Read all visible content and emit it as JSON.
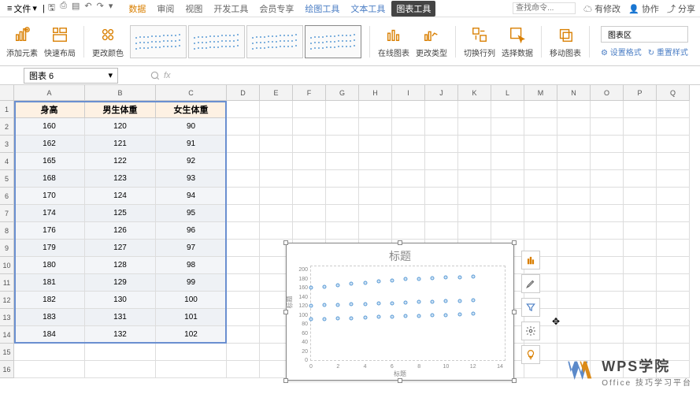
{
  "topbar": {
    "menu": "文件",
    "tabs": [
      "数据",
      "审阅",
      "视图",
      "开发工具",
      "会员专享",
      "绘图工具",
      "文本工具",
      "图表工具"
    ],
    "search_ph": "查找命令...",
    "cloud": "有修改",
    "collab": "协作",
    "share": "分享"
  },
  "ribbon": {
    "g1": "添加元素",
    "g2": "快速布局",
    "g3": "更改颜色",
    "g4": "在线图表",
    "g5": "更改类型",
    "g6": "切换行列",
    "g7": "选择数据",
    "g8": "移动图表",
    "area_label": "图表区",
    "settings": "设置格式",
    "reset": "重置样式"
  },
  "namebox": "图表 6",
  "fx": "fx",
  "table": {
    "headers": [
      "身高",
      "男生体重",
      "女生体重"
    ],
    "rows": [
      [
        "160",
        "120",
        "90"
      ],
      [
        "162",
        "121",
        "91"
      ],
      [
        "165",
        "122",
        "92"
      ],
      [
        "168",
        "123",
        "93"
      ],
      [
        "170",
        "124",
        "94"
      ],
      [
        "174",
        "125",
        "95"
      ],
      [
        "176",
        "126",
        "96"
      ],
      [
        "179",
        "127",
        "97"
      ],
      [
        "180",
        "128",
        "98"
      ],
      [
        "181",
        "129",
        "99"
      ],
      [
        "182",
        "130",
        "100"
      ],
      [
        "183",
        "131",
        "101"
      ],
      [
        "184",
        "132",
        "102"
      ]
    ]
  },
  "cols": [
    "A",
    "B",
    "C",
    "D",
    "E",
    "F",
    "G",
    "H",
    "I",
    "J",
    "K",
    "L",
    "M",
    "N",
    "O",
    "P",
    "Q"
  ],
  "chart": {
    "title": "标题",
    "xlabel": "标题",
    "ylabel": "标题"
  },
  "chart_data": {
    "type": "scatter",
    "x": [
      0,
      1,
      2,
      3,
      4,
      5,
      6,
      7,
      8,
      9,
      10,
      11,
      12
    ],
    "series": [
      {
        "name": "身高",
        "values": [
          160,
          162,
          165,
          168,
          170,
          174,
          176,
          179,
          180,
          181,
          182,
          183,
          184
        ]
      },
      {
        "name": "男生体重",
        "values": [
          120,
          121,
          122,
          123,
          124,
          125,
          126,
          127,
          128,
          129,
          130,
          131,
          132
        ]
      },
      {
        "name": "女生体重",
        "values": [
          90,
          91,
          92,
          93,
          94,
          95,
          96,
          97,
          98,
          99,
          100,
          101,
          102
        ]
      }
    ],
    "title": "标题",
    "xlabel": "标题",
    "ylabel": "标题",
    "xlim": [
      0,
      14
    ],
    "ylim": [
      0,
      200
    ],
    "xticks": [
      0,
      2,
      4,
      6,
      8,
      10,
      12,
      14
    ],
    "yticks": [
      0,
      20,
      40,
      60,
      80,
      100,
      120,
      140,
      160,
      180,
      200
    ]
  },
  "watermark": {
    "title": "WPS学院",
    "subtitle": "Office 技巧学习平台"
  }
}
